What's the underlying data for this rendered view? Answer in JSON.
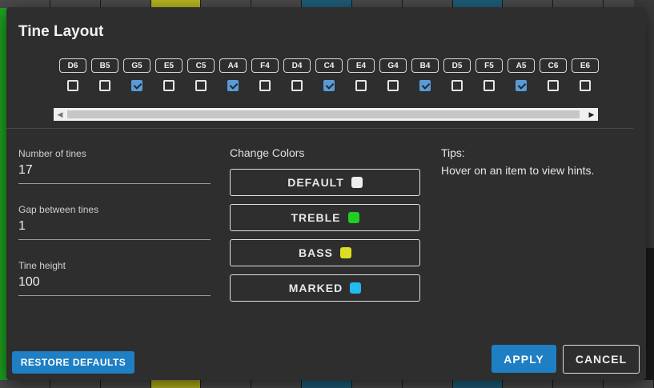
{
  "dialog": {
    "title": "Tine Layout"
  },
  "tines": [
    {
      "label": "D6",
      "checked": false
    },
    {
      "label": "B5",
      "checked": false
    },
    {
      "label": "G5",
      "checked": true
    },
    {
      "label": "E5",
      "checked": false
    },
    {
      "label": "C5",
      "checked": false
    },
    {
      "label": "A4",
      "checked": true
    },
    {
      "label": "F4",
      "checked": false
    },
    {
      "label": "D4",
      "checked": false
    },
    {
      "label": "C4",
      "checked": true
    },
    {
      "label": "E4",
      "checked": false
    },
    {
      "label": "G4",
      "checked": false
    },
    {
      "label": "B4",
      "checked": true
    },
    {
      "label": "D5",
      "checked": false
    },
    {
      "label": "F5",
      "checked": false
    },
    {
      "label": "A5",
      "checked": true
    },
    {
      "label": "C6",
      "checked": false
    },
    {
      "label": "E6",
      "checked": false
    }
  ],
  "settings": {
    "num_tines_label": "Number of tines",
    "num_tines_value": "17",
    "gap_label": "Gap between tines",
    "gap_value": "1",
    "height_label": "Tine height",
    "height_value": "100"
  },
  "colors": {
    "title": "Change Colors",
    "buttons": [
      {
        "label": "DEFAULT",
        "color": "#eeeeee"
      },
      {
        "label": "TREBLE",
        "color": "#22cc22"
      },
      {
        "label": "BASS",
        "color": "#dddd22"
      },
      {
        "label": "MARKED",
        "color": "#22bbee"
      }
    ]
  },
  "tips": {
    "title": "Tips:",
    "text": "Hover on an item to view hints."
  },
  "actions": {
    "restore_label": "RESTORE DEFAULTS",
    "apply_label": "APPLY",
    "cancel_label": "CANCEL"
  },
  "theme": {
    "accent": "#1f7fc4",
    "check_color": "#5b9bd5"
  }
}
